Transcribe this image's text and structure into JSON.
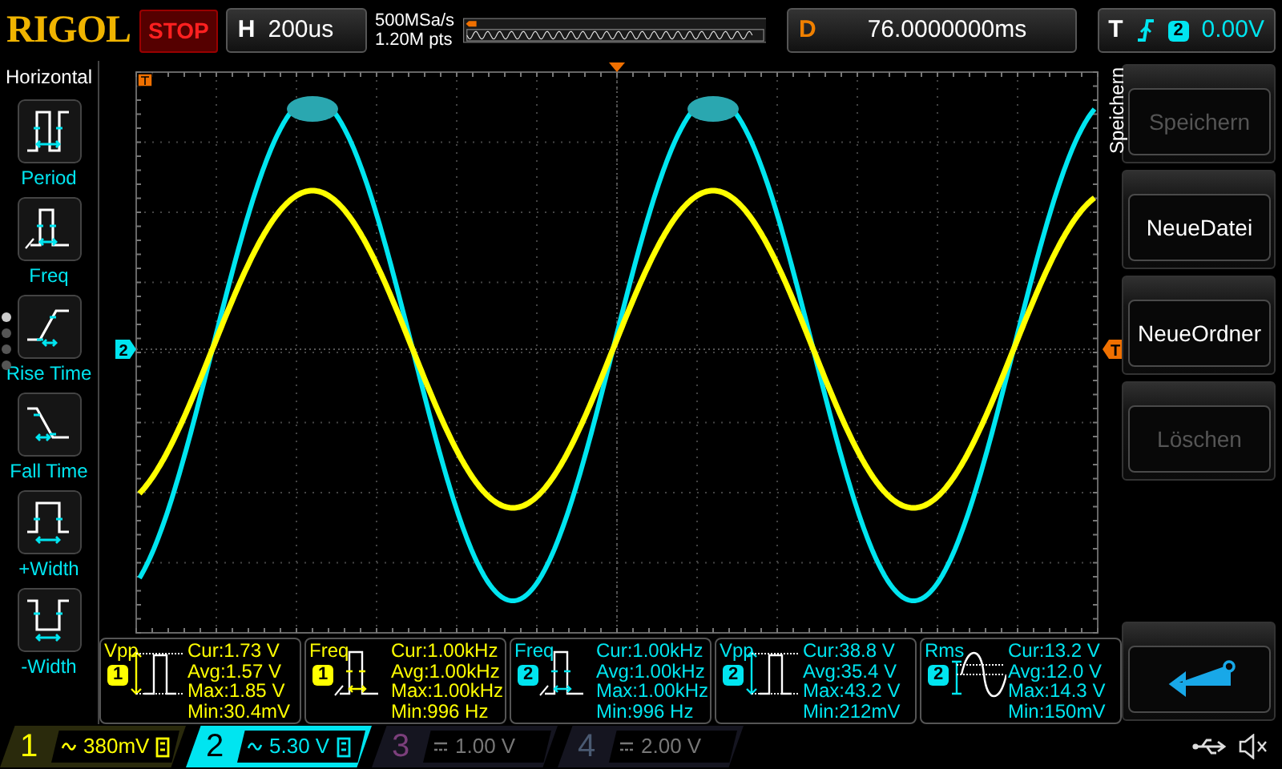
{
  "header": {
    "logo": "RIGOL",
    "run_state": "STOP",
    "timebase": {
      "label": "H",
      "value": "200us"
    },
    "sample_rate": "500MSa/s",
    "memory_depth": "1.20M pts",
    "delay": {
      "label": "D",
      "value": "76.0000000ms"
    },
    "trigger": {
      "label": "T",
      "source": "2",
      "level": "0.00V"
    }
  },
  "left_menu": {
    "title": "Horizontal",
    "items": [
      {
        "kind": "period",
        "label": "Period"
      },
      {
        "kind": "freq",
        "label": "Freq"
      },
      {
        "kind": "rise",
        "label": "Rise Time"
      },
      {
        "kind": "fall",
        "label": "Fall Time"
      },
      {
        "kind": "pwidth",
        "label": "+Width"
      },
      {
        "kind": "nwidth",
        "label": "-Width"
      }
    ],
    "pages": [
      {
        "selected": true
      },
      {
        "selected": false
      },
      {
        "selected": false
      },
      {
        "selected": false
      }
    ]
  },
  "plot": {
    "channel_marker": "2",
    "trigger_marker": "T"
  },
  "right_menu": {
    "tab": "Speichern",
    "buttons": [
      {
        "kind": "text",
        "label": "Speichern",
        "disabled": true
      },
      {
        "kind": "text",
        "label": "NeueDatei",
        "disabled": false
      },
      {
        "kind": "text",
        "label": "NeueOrdner",
        "disabled": false
      },
      {
        "kind": "text",
        "label": "Löschen",
        "disabled": true
      },
      {
        "kind": "back"
      }
    ]
  },
  "measurements": [
    {
      "name": "Vpp",
      "channel": "1",
      "color": "#ffff00",
      "kind": "vpp",
      "lines": [
        "Cur:1.73 V",
        "Avg:1.57 V",
        "Max:1.85 V",
        "Min:30.4mV"
      ]
    },
    {
      "name": "Freq",
      "channel": "1",
      "color": "#ffff00",
      "kind": "freq",
      "lines": [
        "Cur:1.00kHz",
        "Avg:1.00kHz",
        "Max:1.00kHz",
        "Min:996 Hz"
      ]
    },
    {
      "name": "Freq",
      "channel": "2",
      "color": "#00e5f0",
      "kind": "freq",
      "lines": [
        "Cur:1.00kHz",
        "Avg:1.00kHz",
        "Max:1.00kHz",
        "Min:996 Hz"
      ]
    },
    {
      "name": "Vpp",
      "channel": "2",
      "color": "#00e5f0",
      "kind": "vpp",
      "lines": [
        "Cur:38.8 V",
        "Avg:35.4 V",
        "Max:43.2 V",
        "Min:212mV"
      ]
    },
    {
      "name": "Rms",
      "channel": "2",
      "color": "#00e5f0",
      "kind": "rms",
      "lines": [
        "Cur:13.2 V",
        "Avg:12.0 V",
        "Max:14.3 V",
        "Min:150mV"
      ]
    }
  ],
  "channels": [
    {
      "number": "1",
      "color": "#ffff00",
      "kind": "ac",
      "scale": "380mV",
      "bw_limit": true,
      "on": true,
      "selected": false
    },
    {
      "number": "2",
      "color": "#00e5f0",
      "kind": "ac",
      "scale": "5.30 V",
      "bw_limit": true,
      "on": true,
      "selected": true
    },
    {
      "number": "3",
      "color": "#7b3f7b",
      "kind": "dc",
      "scale": "1.00 V",
      "bw_limit": false,
      "on": false,
      "selected": false
    },
    {
      "number": "4",
      "color": "#4a5a72",
      "kind": "dc",
      "scale": "2.00 V",
      "bw_limit": false,
      "on": false,
      "selected": false
    }
  ]
}
